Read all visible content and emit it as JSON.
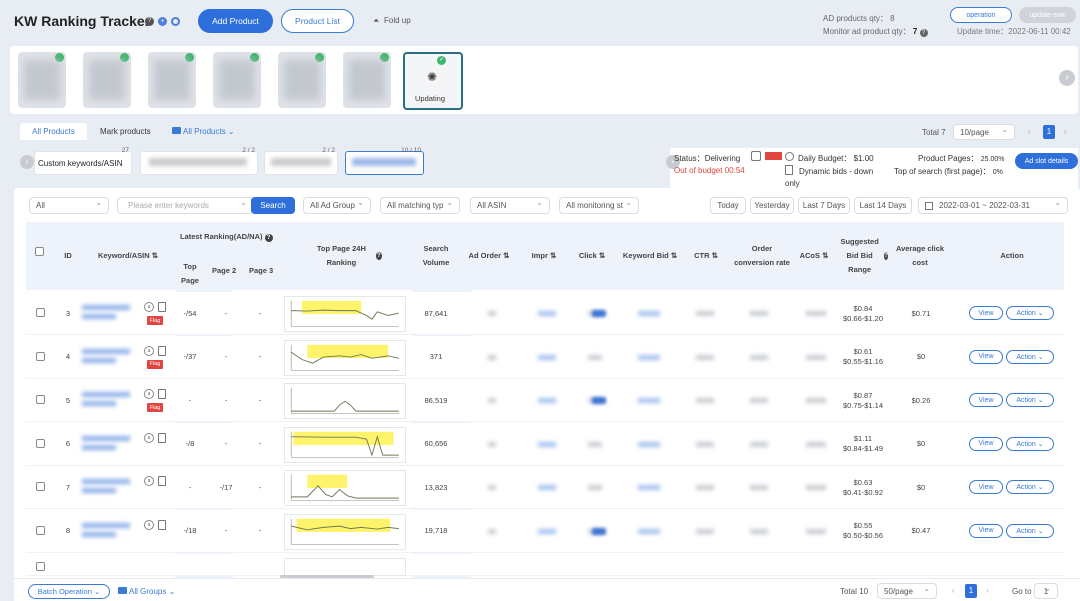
{
  "header": {
    "title": "KW Ranking Tracker",
    "add_product": "Add Product",
    "product_list": "Product List",
    "fold_up": "Fold up",
    "ad_qty_label": "AD products qty：",
    "ad_qty": "8",
    "monitor_qty_label": "Monitor ad product qty：",
    "monitor_qty": "7",
    "operation": "operation",
    "update_now": "update now",
    "update_time_label": "Update time：",
    "update_time": "2022-06-11 00:42"
  },
  "products": {
    "updating_label": "Updating"
  },
  "tabs": {
    "all_products": "All Products",
    "mark_products": "Mark products",
    "all_products_dd": "All Products"
  },
  "pager_top": {
    "total": "Total 7",
    "per_page": "10/page",
    "page": "1"
  },
  "kw_cards": [
    {
      "label": "Custom keywords/ASIN",
      "count": "27"
    },
    {
      "label": "",
      "count": "2 / 2"
    },
    {
      "label": "",
      "count": "2 / 2"
    },
    {
      "label": "",
      "count": "10 / 10"
    }
  ],
  "status": {
    "status_label": "Status：",
    "status_value": "Delivering",
    "budget_note": "Out of budget 00:54",
    "daily_budget_label": "Daily Budget：",
    "daily_budget": "$1.00",
    "dynamic_label": "Dynamic bids - down only",
    "product_pages_label": "Product Pages：",
    "product_pages": "25.00%",
    "top_search_label": "Top of search (first page)：",
    "top_search": "0%",
    "ad_slot": "Ad slot details"
  },
  "filters": {
    "all": "All",
    "search_placeholder": "Please enter keywords",
    "search_btn": "Search",
    "ad_group": "All Ad Group",
    "matching": "All matching typ",
    "asin": "All ASIN",
    "monitoring": "All monitoring st",
    "today": "Today",
    "yesterday": "Yesterday",
    "last7": "Last 7 Days",
    "last14": "Last 14 Days",
    "date_from": "2022-03-01",
    "date_sep": "~",
    "date_to": "2022-03-31"
  },
  "columns": {
    "id": "ID",
    "keyword": "Keyword/ASIN",
    "latest": "Latest Ranking(AD/NA)",
    "top_page": "Top Page",
    "page2": "Page 2",
    "page3": "Page 3",
    "top24": "Top Page 24H Ranking",
    "search_volume": "Search Volume",
    "ad_order": "Ad Order",
    "impr": "Impr",
    "click": "Click",
    "kw_bid": "Keyword Bid",
    "ctr": "CTR",
    "ocr": "Order conversion rate",
    "acos": "ACoS",
    "suggested": "Suggested Bid Bid Range",
    "avg_click": "Average click cost",
    "action": "Action"
  },
  "rows": [
    {
      "id": "3",
      "top": "-/54",
      "p2": "-",
      "p3": "-",
      "sv": "87,641",
      "bid": "$0.84",
      "range": "$0.66-$1.20",
      "avg": "$0.71",
      "flag": "Flag",
      "view": "View",
      "action": "Action"
    },
    {
      "id": "4",
      "top": "-/37",
      "p2": "-",
      "p3": "-",
      "sv": "371",
      "bid": "$0.61",
      "range": "$0.55-$1.16",
      "avg": "$0",
      "flag": "Flag",
      "view": "View",
      "action": "Action"
    },
    {
      "id": "5",
      "top": "-",
      "p2": "-",
      "p3": "-",
      "sv": "86,519",
      "bid": "$0.87",
      "range": "$0.75-$1.14",
      "avg": "$0.26",
      "flag": "Flag",
      "view": "View",
      "action": "Action"
    },
    {
      "id": "6",
      "top": "-/8",
      "p2": "-",
      "p3": "-",
      "sv": "60,656",
      "bid": "$1.11",
      "range": "$0.84-$1.49",
      "avg": "$0",
      "flag": "",
      "view": "View",
      "action": "Action"
    },
    {
      "id": "7",
      "top": "-",
      "p2": "-/17",
      "p3": "-",
      "sv": "13,823",
      "bid": "$0.63",
      "range": "$0.41-$0.92",
      "avg": "$0",
      "flag": "",
      "view": "View",
      "action": "Action"
    },
    {
      "id": "8",
      "top": "-/18",
      "p2": "-",
      "p3": "-",
      "sv": "19,718",
      "bid": "$0.55",
      "range": "$0.50-$0.56",
      "avg": "$0.47",
      "flag": "",
      "view": "View",
      "action": "Action"
    }
  ],
  "footer": {
    "batch": "Batch Operation",
    "groups": "All Groups",
    "total": "Total 10",
    "per_page": "50/page",
    "page": "1",
    "goto": "Go to",
    "goto_val": "1"
  }
}
